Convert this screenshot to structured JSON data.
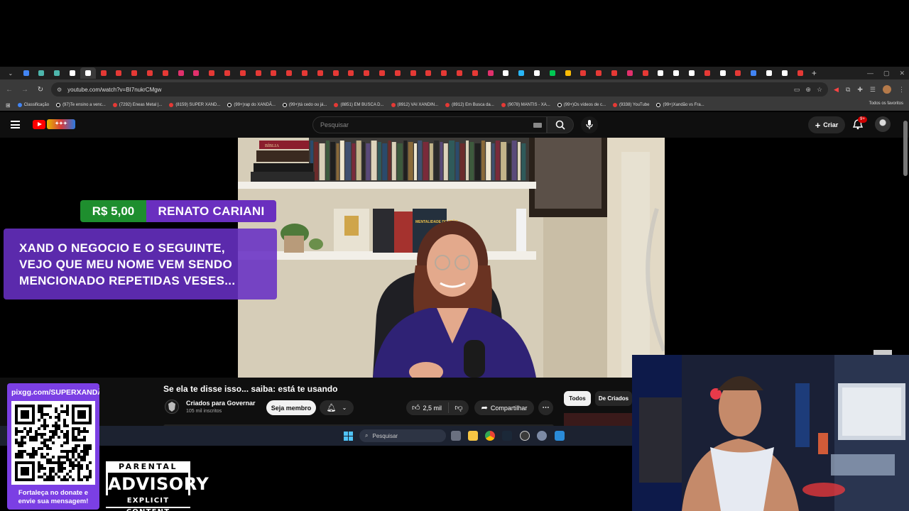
{
  "browser": {
    "url": "youtube.com/watch?v=BI7nukrCMgw",
    "tab_favicon_colors": [
      "#4285f4",
      "#4db6ac",
      "#4db6ac",
      "#ffffff",
      "#ffffff",
      "#e53935",
      "#e53935",
      "#e53935",
      "#e53935",
      "#e53935",
      "#e1306c",
      "#e1306c",
      "#e53935",
      "#e53935",
      "#e53935",
      "#e53935",
      "#e53935",
      "#e53935",
      "#e53935",
      "#e53935",
      "#e53935",
      "#e53935",
      "#e53935",
      "#e53935",
      "#e53935",
      "#e53935",
      "#e53935",
      "#e53935",
      "#e53935",
      "#e53935",
      "#e1306c",
      "#ffffff",
      "#29b6f6",
      "#ffffff",
      "#00c853",
      "#fbbc05",
      "#e53935",
      "#e53935",
      "#e53935",
      "#e1306c",
      "#e53935",
      "#ffffff",
      "#ffffff",
      "#ffffff",
      "#e53935",
      "#ffffff",
      "#e53935",
      "#4285f4",
      "#ffffff",
      "#ffffff",
      "#e53935"
    ],
    "bookmarks": [
      {
        "label": "Classificação",
        "icon": "blue"
      },
      {
        "label": "(97)Te ensino a venc...",
        "icon": "tt"
      },
      {
        "label": "(7292) Eneas Metal |...",
        "icon": "yt"
      },
      {
        "label": "(8159) SUPER XAND...",
        "icon": "yt"
      },
      {
        "label": "(99+)rap do XANDÃ...",
        "icon": "tt"
      },
      {
        "label": "(99+)tá cedo ou já...",
        "icon": "tt"
      },
      {
        "label": "(8851) EM BUSCA D...",
        "icon": "yt"
      },
      {
        "label": "(8912) VAI XANDIN...",
        "icon": "yt"
      },
      {
        "label": "(8912) Em Busca da...",
        "icon": "yt"
      },
      {
        "label": "(9078) MANTIS - XA...",
        "icon": "yt"
      },
      {
        "label": "(99+)Os vídeos de c...",
        "icon": "tt"
      },
      {
        "label": "(9338) YouTube",
        "icon": "yt"
      },
      {
        "label": "(99+)Xandão vs Fra...",
        "icon": "tt"
      }
    ],
    "bookmarks_all": "Todos os favoritos"
  },
  "youtube": {
    "search_placeholder": "Pesquisar",
    "create_label": "Criar",
    "notification_badge": "9+",
    "video_title": "Se ela te disse isso... saiba: está te usando",
    "channel_name": "Criados para Governar",
    "channel_subs": "105 mil inscritos",
    "member_button": "Seja membro",
    "likes": "2,5 mil",
    "share_label": "Compartilhar",
    "chip_all": "Todos",
    "chip_de": "De Criados"
  },
  "donation": {
    "amount": "R$ 5,00",
    "donor": "RENATO CARIANI",
    "message_lines": [
      "XAND O NEGOCIO E O SEGUINTE,",
      "VEJO QUE MEU NOME VEM SENDO",
      "MENCIONADO REPETIDAS VESES..."
    ]
  },
  "qr_panel": {
    "url": "pixgg.com/SUPERXANDÃO",
    "footer_1": "Fortaleça no donate e",
    "footer_2": "envie sua mensagem!"
  },
  "parental_advisory": {
    "top": "PARENTAL",
    "mid": "ADVISORY",
    "bottom": "EXPLICIT CONTENT"
  },
  "taskbar": {
    "search_label": "Pesquisar"
  },
  "video_book_titles": {
    "book_red": "BÍBLIA",
    "book_mentalidade": "MENTALIDADE DE FRÃO"
  }
}
